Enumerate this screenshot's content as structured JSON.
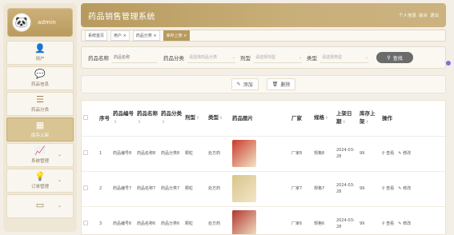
{
  "header": {
    "title": "药品销售管理系统",
    "links": [
      "个人信息",
      "前台",
      "退出"
    ]
  },
  "user": {
    "name": "admin"
  },
  "sidebar": {
    "items": [
      {
        "label": "用户",
        "icon": "user-icon",
        "glyph": "👤",
        "chevron": ""
      },
      {
        "label": "药品信息",
        "icon": "message-icon",
        "glyph": "💬",
        "chevron": ""
      },
      {
        "label": "药品分类",
        "icon": "list-icon",
        "glyph": "☰",
        "chevron": ""
      },
      {
        "label": "库存上架",
        "icon": "grid-icon",
        "glyph": "▦",
        "chevron": "",
        "active": true
      },
      {
        "label": "系统管理",
        "icon": "chart-icon",
        "glyph": "📈",
        "chevron": "⌄"
      },
      {
        "label": "订单管理",
        "icon": "bulb-icon",
        "glyph": "💡",
        "chevron": "⌄"
      },
      {
        "label": "",
        "icon": "card-icon",
        "glyph": "▭",
        "chevron": "⌄"
      }
    ]
  },
  "tabs": [
    {
      "label": "系统首页",
      "active": false
    },
    {
      "label": "用户 ×",
      "active": false
    },
    {
      "label": "药品分类 ×",
      "active": false
    },
    {
      "label": "库存上架 ×",
      "active": true
    }
  ],
  "search": {
    "name_label": "药品名称",
    "name_placeholder": "药品名称",
    "cat_label": "药品分类",
    "cat_placeholder": "请选择药品分类",
    "form_label": "剂型",
    "form_placeholder": "请选择剂型",
    "type_label": "类型",
    "type_placeholder": "请选择类型",
    "button": "查找"
  },
  "actions": {
    "add": "添加",
    "delete": "删除"
  },
  "table": {
    "headers": [
      "序号",
      "药品编号",
      "药品名称",
      "药品分类",
      "剂型",
      "类型",
      "药品图片",
      "厂家",
      "规格",
      "上架日期",
      "库存上架",
      "操作"
    ],
    "rows": [
      {
        "idx": "1",
        "code": "药品编号8",
        "name": "药品名称8",
        "cat": "药品分类8",
        "form": "颗粒",
        "type": "处方药",
        "vendor": "厂家8",
        "spec": "规格8",
        "date": "2024-03-28",
        "stock": "99",
        "view": "查看",
        "edit": "修改",
        "img_color": "#c93a2a"
      },
      {
        "idx": "2",
        "code": "药品编号7",
        "name": "药品名称7",
        "cat": "药品分类7",
        "form": "颗粒",
        "type": "处方药",
        "vendor": "厂家7",
        "spec": "规格7",
        "date": "2024-03-28",
        "stock": "99",
        "view": "查看",
        "edit": "修改",
        "img_color": "#d8c48a"
      },
      {
        "idx": "3",
        "code": "药品编号6",
        "name": "药品名称6",
        "cat": "药品分类6",
        "form": "颗粒",
        "type": "处方药",
        "vendor": "厂家6",
        "spec": "规格6",
        "date": "2024-03-28",
        "stock": "99",
        "view": "查看",
        "edit": "修改",
        "img_color": "#b3362f"
      }
    ]
  },
  "colors": {
    "accent": "#b89a5c",
    "active_menu": "#d8c593",
    "search_button": "#6b6b6b"
  }
}
